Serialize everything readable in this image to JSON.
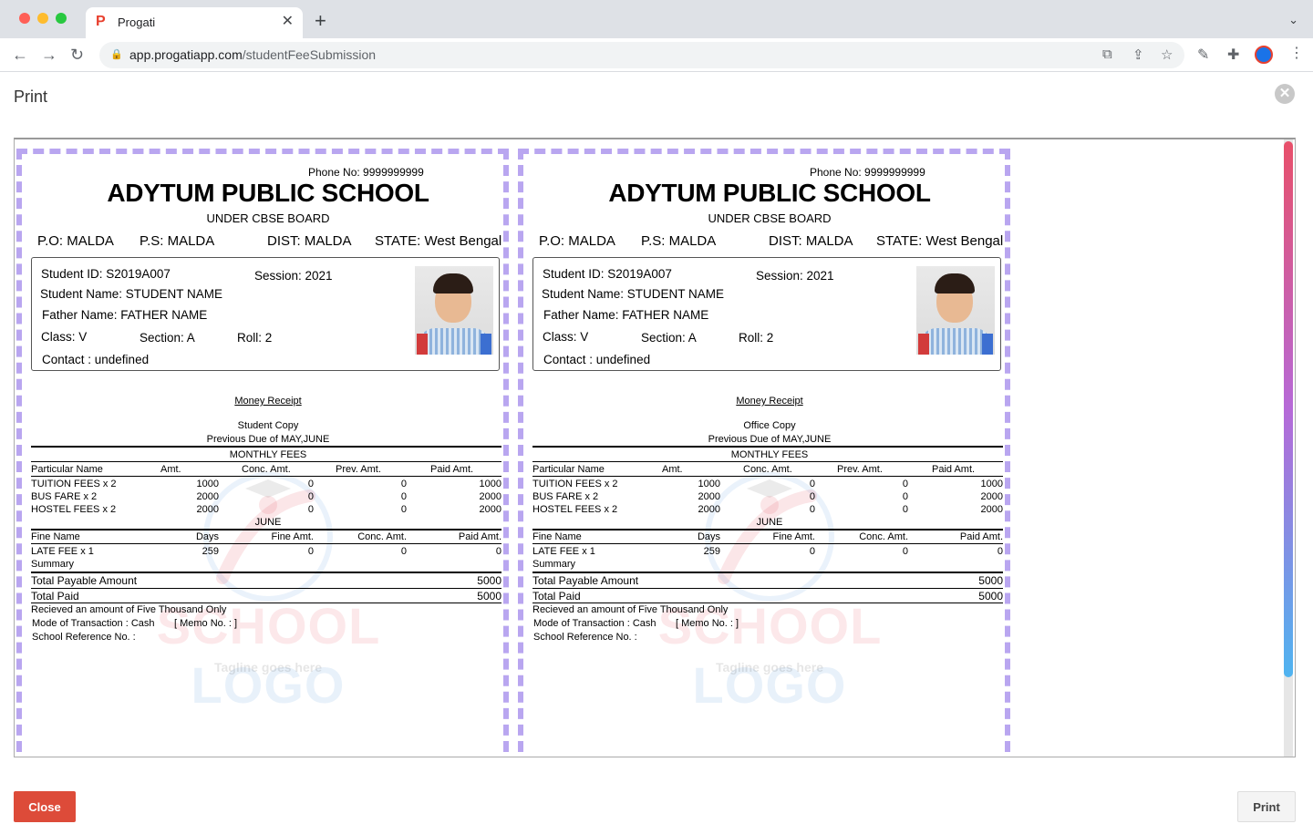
{
  "browser": {
    "tab_title": "Progati",
    "url_host": "app.progatiapp.com",
    "url_path": "/studentFeeSubmission"
  },
  "modal": {
    "title": "Print",
    "close_label": "Close",
    "print_label": "Print"
  },
  "receipt": {
    "phone": "Phone No: 9999999999",
    "school_name": "ADYTUM PUBLIC SCHOOL",
    "board": "UNDER CBSE BOARD",
    "po": "P.O: MALDA",
    "ps": "P.S: MALDA",
    "dist": "DIST: MALDA",
    "state": "STATE: West Bengal",
    "student_id": "Student ID: S2019A007",
    "session": "Session: 2021",
    "student_name": "Student Name: STUDENT NAME",
    "father_name": "Father Name: FATHER NAME",
    "class": "Class: V",
    "section": "Section: A",
    "roll": "Roll: 2",
    "contact": "Contact : undefined",
    "money_receipt": "Money Receipt",
    "previous_due": "Previous Due of MAY,JUNE",
    "monthly_fees": "MONTHLY FEES",
    "fee_headers": [
      "Particular Name",
      "Amt.",
      "Conc. Amt.",
      "Prev. Amt.",
      "Paid Amt."
    ],
    "fees": [
      {
        "name": "TUITION FEES x 2",
        "amt": "1000",
        "conc": "0",
        "prev": "0",
        "paid": "1000"
      },
      {
        "name": "BUS FARE x 2",
        "amt": "2000",
        "conc": "0",
        "prev": "0",
        "paid": "2000"
      },
      {
        "name": "HOSTEL FEES x 2",
        "amt": "2000",
        "conc": "0",
        "prev": "0",
        "paid": "2000"
      }
    ],
    "month": "JUNE",
    "fine_headers": [
      "Fine Name",
      "Days",
      "Fine Amt.",
      "Conc. Amt.",
      "Paid Amt."
    ],
    "fines": [
      {
        "name": "LATE FEE x 1",
        "days": "259",
        "fine": "0",
        "conc": "0",
        "paid": "0"
      }
    ],
    "summary_label": "Summary",
    "total_payable_label": "Total Payable Amount",
    "total_payable": "5000",
    "total_paid_label": "Total Paid",
    "total_paid": "5000",
    "received_text": "Recieved an amount of Five Thousand Only",
    "mode_text": "Mode of Transaction : Cash",
    "memo_text": "[ Memo No. : ]",
    "reference_text": "School Reference No. :",
    "watermark_school": "SCHOOL",
    "watermark_logo": "LOGO",
    "watermark_tagline": "Tagline goes here"
  },
  "copies": [
    {
      "copy_label": "Student Copy"
    },
    {
      "copy_label": "Office Copy"
    }
  ]
}
